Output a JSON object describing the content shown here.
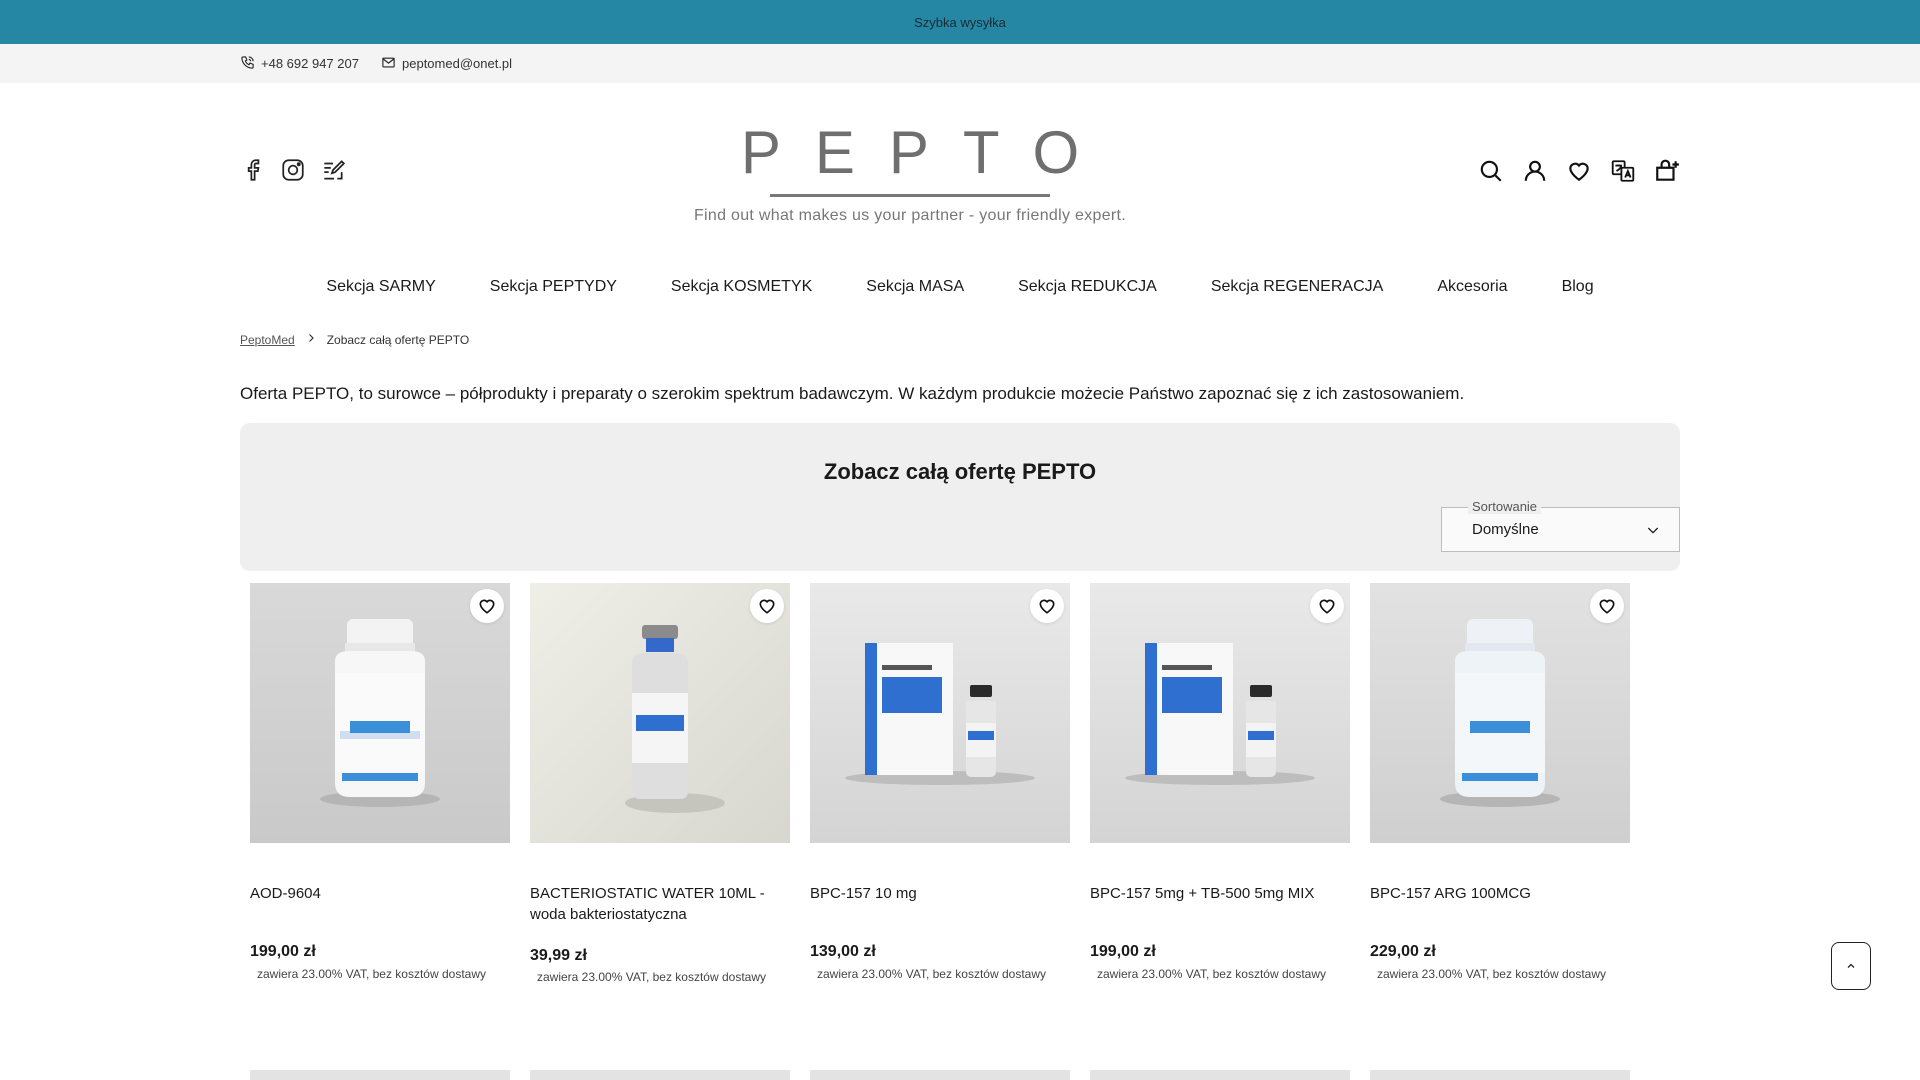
{
  "topbar": {
    "text": "Szybka wysyłka"
  },
  "contact": {
    "phone": "+48 692 947 207",
    "email": "peptomed@onet.pl"
  },
  "social": {
    "icons": [
      "facebook-icon",
      "instagram-icon",
      "blog-icon"
    ]
  },
  "logo": {
    "word": "PEPTO",
    "tagline": "Find out what makes us your partner - your friendly expert."
  },
  "header_actions": {
    "icons": [
      "search-icon",
      "user-icon",
      "heart-icon",
      "translate-icon",
      "cart-icon"
    ]
  },
  "nav": {
    "items": [
      "Sekcja SARMY",
      "Sekcja PEPTYDY",
      "Sekcja KOSMETYK",
      "Sekcja MASA",
      "Sekcja REDUKCJA",
      "Sekcja REGENERACJA",
      "Akcesoria",
      "Blog"
    ]
  },
  "breadcrumb": {
    "home": "PeptoMed",
    "current": "Zobacz całą ofertę PEPTO"
  },
  "intro": "Oferta PEPTO, to surowce – półprodukty i preparaty o szerokim spektrum badawczym. W każdym produkcie możecie Państwo zapoznać się z ich zastosowaniem.",
  "listing": {
    "title": "Zobacz całą ofertę PEPTO",
    "sort_label": "Sortowanie",
    "sort_value": "Domyślne"
  },
  "products": [
    {
      "name": "AOD-9604",
      "price": "199,00 zł",
      "vat": "zawiera 23.00% VAT, bez kosztów dostawy",
      "label": "AOD-9604"
    },
    {
      "name": "BACTERIOSTATIC WATER 10ML - woda bakteriostatyczna",
      "price": "39,99 zł",
      "vat": "zawiera 23.00% VAT, bez kosztów dostawy",
      "label": "BACTERIOSTATIC WATER"
    },
    {
      "name": "BPC-157 10 mg",
      "price": "139,00 zł",
      "vat": "zawiera 23.00% VAT, bez kosztów dostawy",
      "label": "BPC-157"
    },
    {
      "name": "BPC-157 5mg + TB-500 5mg MIX",
      "price": "199,00 zł",
      "vat": "zawiera 23.00% VAT, bez kosztów dostawy",
      "label": "BPC-157 + TB-500"
    },
    {
      "name": "BPC-157 ARG 100MCG",
      "price": "229,00 zł",
      "vat": "zawiera 23.00% VAT, bez kosztów dostawy",
      "label": "BPC-157 ARG"
    }
  ],
  "colors": {
    "topbar": "#2587a3",
    "accent_blue": "#2f7fd0"
  }
}
